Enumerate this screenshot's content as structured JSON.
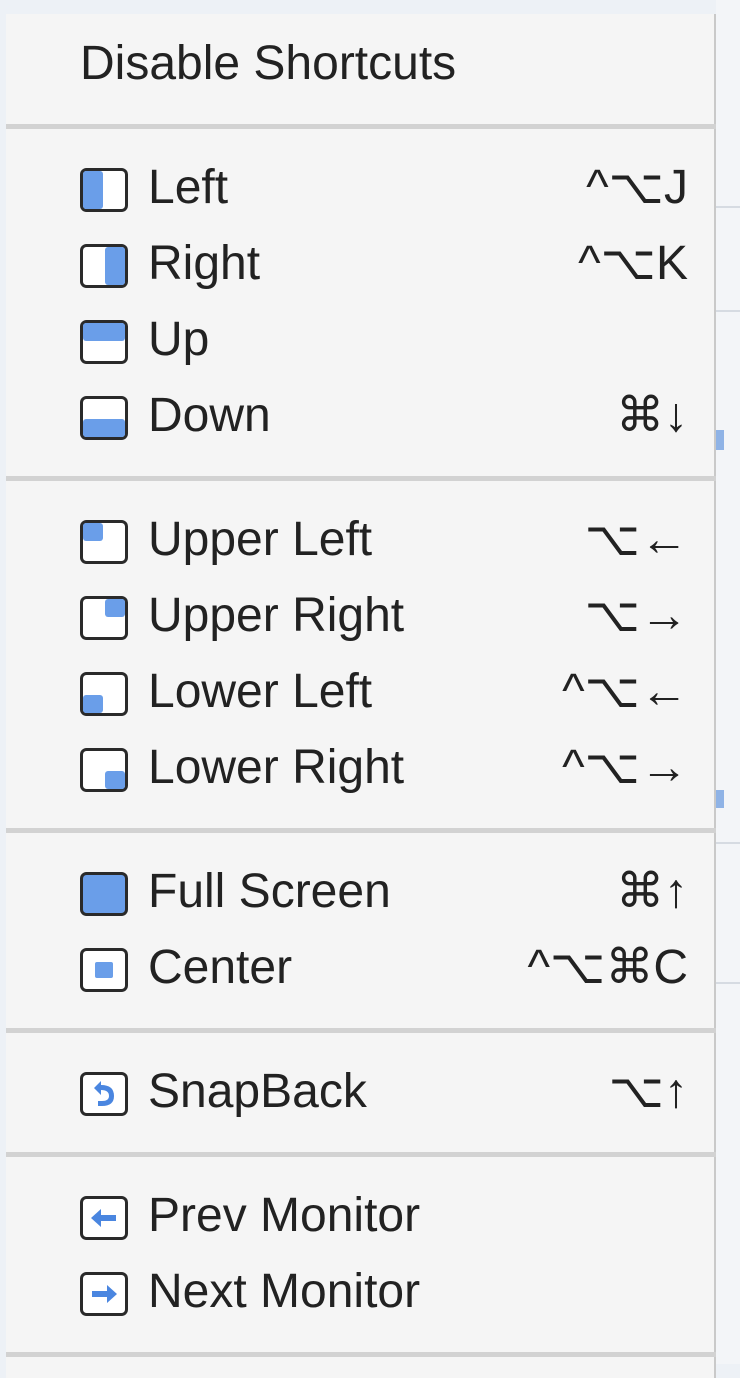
{
  "menu": {
    "title": "Disable Shortcuts",
    "groups": [
      {
        "items": [
          {
            "label": "Left",
            "shortcut": "^⌥J",
            "icon": "half-left-icon"
          },
          {
            "label": "Right",
            "shortcut": "^⌥K",
            "icon": "half-right-icon"
          },
          {
            "label": "Up",
            "shortcut": "",
            "icon": "half-top-icon"
          },
          {
            "label": "Down",
            "shortcut": "⌘↓",
            "icon": "half-bottom-icon"
          }
        ]
      },
      {
        "items": [
          {
            "label": "Upper Left",
            "shortcut": "⌥←",
            "icon": "quarter-upper-left-icon"
          },
          {
            "label": "Upper Right",
            "shortcut": "⌥→",
            "icon": "quarter-upper-right-icon"
          },
          {
            "label": "Lower Left",
            "shortcut": "^⌥←",
            "icon": "quarter-lower-left-icon"
          },
          {
            "label": "Lower Right",
            "shortcut": "^⌥→",
            "icon": "quarter-lower-right-icon"
          }
        ]
      },
      {
        "items": [
          {
            "label": "Full Screen",
            "shortcut": "⌘↑",
            "icon": "full-screen-icon"
          },
          {
            "label": "Center",
            "shortcut": "^⌥⌘C",
            "icon": "center-icon"
          }
        ]
      },
      {
        "items": [
          {
            "label": "SnapBack",
            "shortcut": "⌥↑",
            "icon": "snapback-icon"
          }
        ]
      },
      {
        "items": [
          {
            "label": "Prev Monitor",
            "shortcut": "",
            "icon": "prev-monitor-icon"
          },
          {
            "label": "Next Monitor",
            "shortcut": "",
            "icon": "next-monitor-icon"
          }
        ]
      }
    ]
  },
  "colors": {
    "accent": "#5b93e8",
    "accentLight": "#bcd5f7",
    "text": "#222222",
    "separator": "#d2d2d2"
  }
}
